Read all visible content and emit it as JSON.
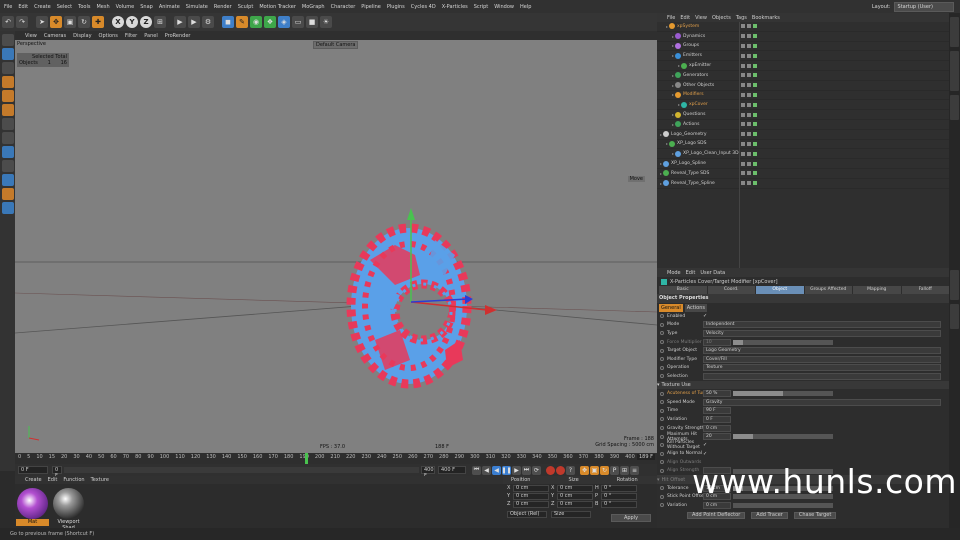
{
  "menubar": {
    "items": [
      "File",
      "Edit",
      "Create",
      "Select",
      "Tools",
      "Mesh",
      "Volume",
      "Snap",
      "Animate",
      "Simulate",
      "Render",
      "Sculpt",
      "Motion Tracker",
      "MoGraph",
      "Character",
      "Pipeline",
      "Plugins",
      "Cycles 4D",
      "X-Particles",
      "Script",
      "Window",
      "Help"
    ],
    "layout_label": "Layout:",
    "layout_value": "Startup (User)"
  },
  "toolbar": {
    "axis_x": "X",
    "axis_y": "Y",
    "axis_z": "Z"
  },
  "viewport": {
    "menu": [
      "View",
      "Cameras",
      "Display",
      "Options",
      "Filter",
      "Panel",
      "ProRender"
    ],
    "label": "Perspective",
    "camera": "Default Camera",
    "hud_header": "Selected Total",
    "hud_row_label": "Objects",
    "hud_row_value1": "1",
    "hud_row_value2": "16",
    "move_label": "Move",
    "fps": "FPS : 37.0",
    "frame_readout": "188 F",
    "frame_label": "Frame : 188",
    "grid_spacing": "Grid Spacing : 5000 cm"
  },
  "timeline": {
    "ticks": [
      "0",
      "5",
      "10",
      "15",
      "20",
      "30",
      "40",
      "50",
      "60",
      "70",
      "80",
      "90",
      "100",
      "110",
      "120",
      "130",
      "140",
      "150",
      "160",
      "170",
      "180",
      "190",
      "200",
      "210",
      "220",
      "230",
      "240",
      "250",
      "260",
      "270",
      "280",
      "290",
      "300",
      "310",
      "320",
      "330",
      "340",
      "350",
      "360",
      "370",
      "380",
      "390",
      "400"
    ],
    "current_frame": "189 F"
  },
  "transport": {
    "start_field": "0 F",
    "start_field2": "0 F",
    "end_field": "400 F",
    "end_field2": "400 F"
  },
  "materials": {
    "menu": [
      "Create",
      "Edit",
      "Function",
      "Texture"
    ],
    "items": [
      {
        "name": "Mat"
      },
      {
        "name": "Viewport Shad"
      }
    ]
  },
  "coords": {
    "headers": [
      "Position",
      "Size",
      "Rotation"
    ],
    "rows": [
      {
        "pos": "0 cm",
        "size": "0 cm",
        "rot_label": "H",
        "rot": "0 °",
        "pos_label": "X",
        "size_label": "X"
      },
      {
        "pos": "0 cm",
        "size": "0 cm",
        "rot_label": "P",
        "rot": "0 °",
        "pos_label": "Y",
        "size_label": "Y"
      },
      {
        "pos": "0 cm",
        "size": "0 cm",
        "rot_label": "B",
        "rot": "0 °",
        "pos_label": "Z",
        "size_label": "Z"
      }
    ],
    "mode1": "Object (Rel)",
    "mode2": "Size",
    "apply": "Apply"
  },
  "object_manager": {
    "menu": [
      "File",
      "Edit",
      "View",
      "Objects",
      "Tags",
      "Bookmarks"
    ],
    "objects": [
      {
        "name": "xpSystem",
        "indent": 1,
        "color": "#e59a2f",
        "name_color": "#e3a04a"
      },
      {
        "name": "Dynamics",
        "indent": 2,
        "color": "#9a5bd0",
        "name_color": "#cfcfcf"
      },
      {
        "name": "Groups",
        "indent": 2,
        "color": "#b070e0",
        "name_color": "#cfcfcf"
      },
      {
        "name": "Emitters",
        "indent": 2,
        "color": "#3a8fd8",
        "name_color": "#cfcfcf"
      },
      {
        "name": "xpEmitter",
        "indent": 3,
        "color": "#4caf50",
        "name_color": "#cfcfcf"
      },
      {
        "name": "Generators",
        "indent": 2,
        "color": "#3fa35a",
        "name_color": "#cfcfcf"
      },
      {
        "name": "Other Objects",
        "indent": 2,
        "color": "#888888",
        "name_color": "#cfcfcf"
      },
      {
        "name": "Modifiers",
        "indent": 2,
        "color": "#e59a2f",
        "name_color": "#e3a04a"
      },
      {
        "name": "xpCover",
        "indent": 3,
        "color": "#2fb5a5",
        "name_color": "#e3a04a"
      },
      {
        "name": "Questions",
        "indent": 2,
        "color": "#d1b42f",
        "name_color": "#cfcfcf"
      },
      {
        "name": "Actions",
        "indent": 2,
        "color": "#3fa35a",
        "name_color": "#cfcfcf"
      },
      {
        "name": "Logo_Geometry",
        "indent": 0,
        "color": "#cccccc",
        "name_color": "#cfcfcf"
      },
      {
        "name": "XP_Logo SDS",
        "indent": 1,
        "color": "#4caf50",
        "name_color": "#cfcfcf"
      },
      {
        "name": "XP_Logo_Clean_Input 3D",
        "indent": 2,
        "color": "#5fa0e0",
        "name_color": "#cfcfcf"
      },
      {
        "name": "XP_Logo_Spline",
        "indent": 0,
        "color": "#5fa0e0",
        "name_color": "#cfcfcf"
      },
      {
        "name": "Reveal_Type SDS",
        "indent": 0,
        "color": "#4caf50",
        "name_color": "#cfcfcf"
      },
      {
        "name": "Reveal_Type_Spline",
        "indent": 0,
        "color": "#5fa0e0",
        "name_color": "#cfcfcf"
      }
    ]
  },
  "attributes": {
    "menu": [
      "Mode",
      "Edit",
      "User Data"
    ],
    "title": "X-Particles Cover/Target Modifier [xpCover]",
    "tabs": [
      "Basic",
      "Coord.",
      "Object",
      "Groups Affected",
      "Mapping",
      "Falloff"
    ],
    "active_tab": "Object",
    "section": "Object Properties",
    "subtabs": [
      "General",
      "Actions"
    ],
    "properties": [
      {
        "label": "Enabled",
        "value": "✓",
        "type": "check"
      },
      {
        "label": "Mode",
        "value": "Independent",
        "type": "dropdown"
      },
      {
        "label": "Type",
        "value": "Velocity",
        "type": "dropdown"
      },
      {
        "label": "Force Multiplier",
        "value": "10",
        "type": "slider",
        "dim": true,
        "fill": 0.1
      },
      {
        "label": "Target Object",
        "value": "Logo Geometry",
        "type": "link"
      },
      {
        "label": "Modifier Type",
        "value": "Cover/Fill",
        "type": "dropdown"
      },
      {
        "label": "Operation",
        "value": "Texture",
        "type": "dropdown"
      },
      {
        "label": "Selection",
        "value": "",
        "type": "link"
      },
      {
        "label": "Texture Use",
        "value": "",
        "type": "section"
      },
      {
        "label": "Acuteness of Turn",
        "value": "50 %",
        "type": "slider",
        "orange": true,
        "fill": 0.5
      },
      {
        "label": "Speed Mode",
        "value": "Gravity",
        "type": "dropdown"
      },
      {
        "label": "Time",
        "value": "90 F",
        "type": "field"
      },
      {
        "label": "Variation",
        "value": "0 F",
        "type": "field"
      },
      {
        "label": "Gravity Strength",
        "value": "0 cm",
        "type": "field"
      },
      {
        "label": "Maximum Hit Attempts",
        "value": "20",
        "type": "slider",
        "fill": 0.2
      },
      {
        "label": "Kill Particles Without Target",
        "value": "✓",
        "type": "check"
      },
      {
        "label": "Align to Normal",
        "value": "✓",
        "type": "check"
      },
      {
        "label": "Align Outwards",
        "value": "",
        "type": "check",
        "dim": true
      },
      {
        "label": "Align Strength",
        "value": "",
        "type": "slider",
        "dim": true,
        "fill": 0
      },
      {
        "label": "Hit Offset",
        "value": "",
        "type": "section",
        "dim": true
      },
      {
        "label": "Tolerance",
        "value": "10 cm",
        "type": "slider",
        "fill": 0.1
      },
      {
        "label": "Stick Point Offset",
        "value": "0 cm",
        "type": "slider",
        "fill": 0
      },
      {
        "label": "Variation",
        "value": "0 cm",
        "type": "slider",
        "fill": 0
      }
    ],
    "buttons": [
      "Add Point Deflector",
      "Add Tracer",
      "Chase Target"
    ]
  },
  "statusbar": {
    "text": "Go to previous frame (Shortcut F)"
  },
  "watermark": "www.hunls.com"
}
